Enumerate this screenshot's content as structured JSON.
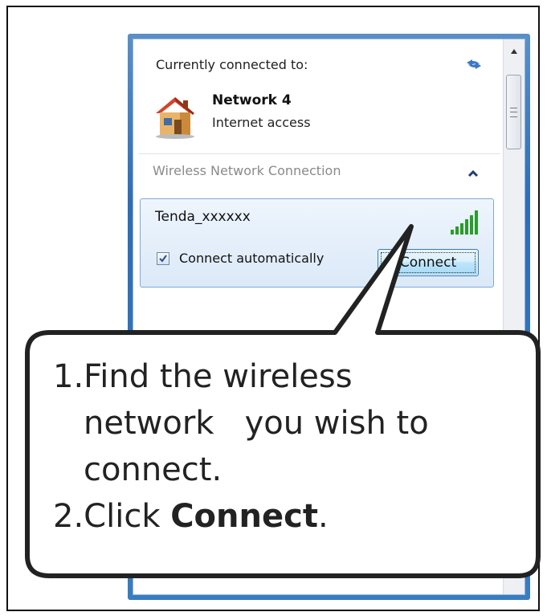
{
  "flyout": {
    "currently_connected_label": "Currently connected to:",
    "network_name": "Network 4",
    "network_status": "Internet access",
    "section_label": "Wireless Network Connection",
    "wireless_item": {
      "ssid": "Tenda_xxxxxx",
      "auto_connect_label": "Connect automatically",
      "auto_connect_checked": true,
      "connect_button_label": "Connect"
    },
    "icons": {
      "refresh": "refresh-icon",
      "house": "house-icon",
      "collapse": "chevron-up-icon",
      "signal": "signal-strength-icon",
      "scroll_up": "scroll-up-arrow-icon"
    }
  },
  "callout": {
    "line1": "1.Find the wireless",
    "line2": "network   you wish to",
    "line3": "connect.",
    "line4_prefix": "2.Click ",
    "line4_bold": "Connect",
    "line4_suffix": "."
  },
  "colors": {
    "flyout_border": "#2f6db4",
    "item_highlight": "#dbe9f8",
    "signal_green": "#2a9d2a",
    "callout_outline": "#222222"
  }
}
